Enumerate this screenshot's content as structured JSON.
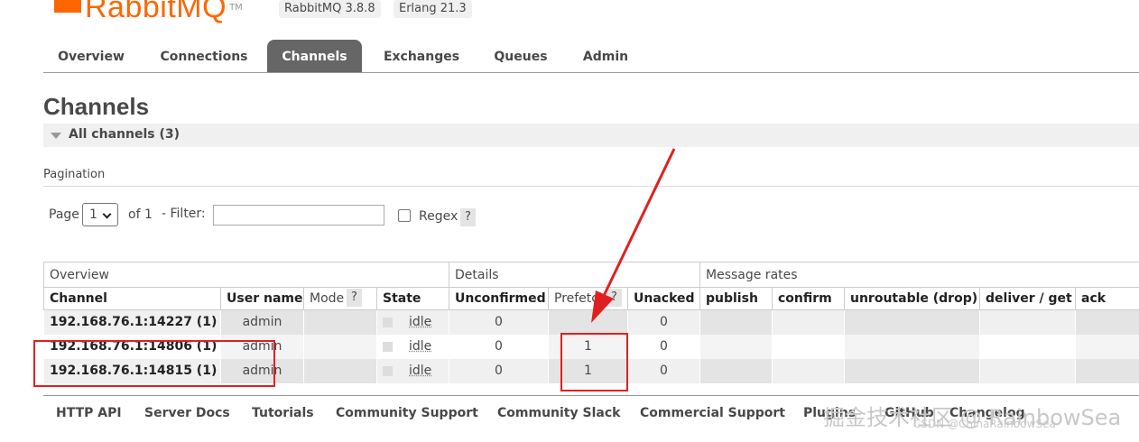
{
  "header": {
    "logo_text": "RabbitMQ",
    "logo_tm": "TM",
    "version_rabbit": "RabbitMQ 3.8.8",
    "version_erlang": "Erlang 21.3"
  },
  "tabs": [
    {
      "label": "Overview",
      "active": false
    },
    {
      "label": "Connections",
      "active": false
    },
    {
      "label": "Channels",
      "active": true
    },
    {
      "label": "Exchanges",
      "active": false
    },
    {
      "label": "Queues",
      "active": false
    },
    {
      "label": "Admin",
      "active": false
    }
  ],
  "page_title": "Channels",
  "section": {
    "title": "All channels (3)"
  },
  "pagination": {
    "label": "Pagination",
    "page_label": "Page",
    "page_value": "1",
    "of_label": "of 1",
    "filter_label": "- Filter:",
    "filter_value": "",
    "regex_label": "Regex",
    "regex_checked": false,
    "help": "?"
  },
  "table": {
    "groups": [
      "Overview",
      "Details",
      "Message rates"
    ],
    "columns": [
      "Channel",
      "User name",
      "Mode",
      "State",
      "Unconfirmed",
      "Prefetch",
      "Unacked",
      "publish",
      "confirm",
      "unroutable (drop)",
      "deliver / get",
      "ack"
    ],
    "help": "?",
    "rows": [
      {
        "channel": "192.168.76.1:14227 (1)",
        "user": "admin",
        "mode": "",
        "state": "idle",
        "unconfirmed": "0",
        "prefetch": "",
        "unacked": "0"
      },
      {
        "channel": "192.168.76.1:14806 (1)",
        "user": "admin",
        "mode": "",
        "state": "idle",
        "unconfirmed": "0",
        "prefetch": "1",
        "unacked": "0"
      },
      {
        "channel": "192.168.76.1:14815 (1)",
        "user": "admin",
        "mode": "",
        "state": "idle",
        "unconfirmed": "0",
        "prefetch": "1",
        "unacked": "0"
      }
    ]
  },
  "footer": {
    "links": [
      "HTTP API",
      "Server Docs",
      "Tutorials",
      "Community Support",
      "Community Slack",
      "Commercial Support",
      "Plugins",
      "GitHub",
      "Changelog"
    ]
  },
  "watermark": {
    "main": "掘金技术社区 @ RainbowSea",
    "small": "CSDN @ChinaRainbowSea"
  },
  "colors": {
    "brand": "#ff6600",
    "active_tab": "#666666",
    "annotation": "#e02020"
  }
}
